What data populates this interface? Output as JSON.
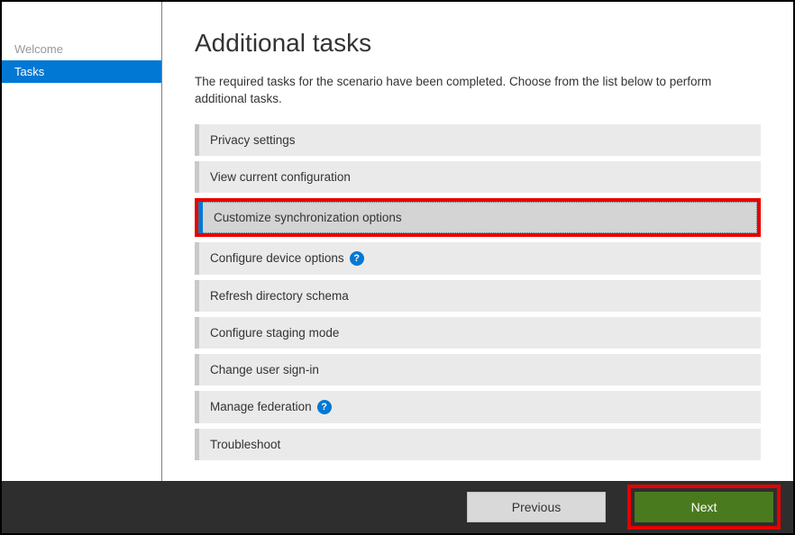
{
  "sidebar": {
    "items": [
      {
        "label": "Welcome"
      },
      {
        "label": "Tasks"
      }
    ]
  },
  "main": {
    "title": "Additional tasks",
    "description": "The required tasks for the scenario have been completed. Choose from the list below to perform additional tasks.",
    "tasks": [
      {
        "label": "Privacy settings",
        "has_help": false
      },
      {
        "label": "View current configuration",
        "has_help": false
      },
      {
        "label": "Customize synchronization options",
        "has_help": false,
        "selected": true
      },
      {
        "label": "Configure device options",
        "has_help": true
      },
      {
        "label": "Refresh directory schema",
        "has_help": false
      },
      {
        "label": "Configure staging mode",
        "has_help": false
      },
      {
        "label": "Change user sign-in",
        "has_help": false
      },
      {
        "label": "Manage federation",
        "has_help": true
      },
      {
        "label": "Troubleshoot",
        "has_help": false
      }
    ]
  },
  "footer": {
    "previous_label": "Previous",
    "next_label": "Next"
  },
  "help_glyph": "?"
}
